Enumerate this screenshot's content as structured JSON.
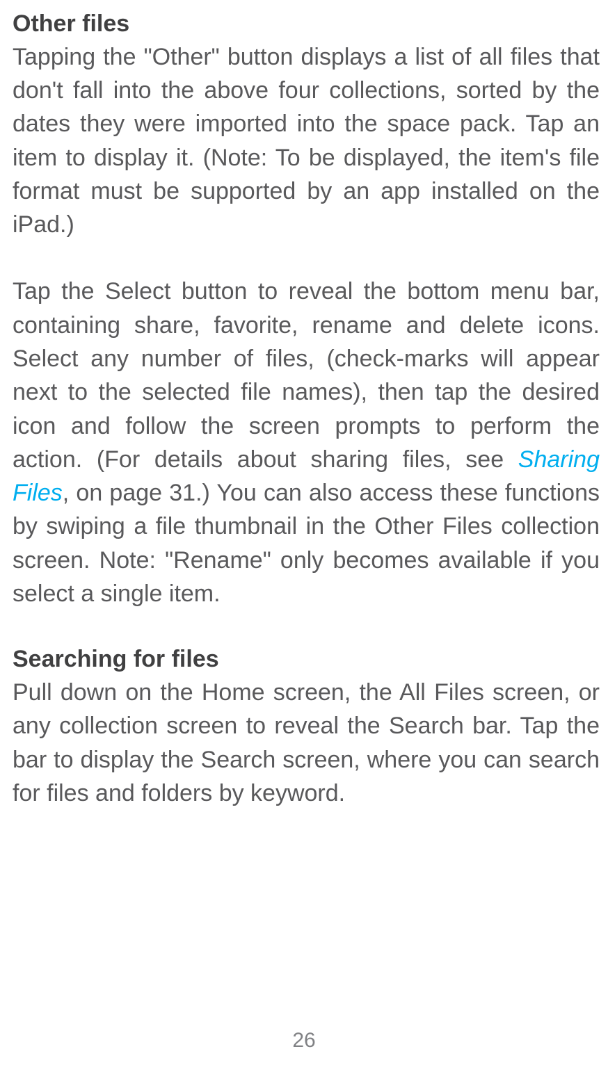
{
  "section1": {
    "heading": "Other files",
    "para1": "Tapping the \"Other\" button displays a list of all files that don't fall into the above four collections, sorted by the dates they were imported into the space pack. Tap an item to display it. (Note: To be displayed, the item's file format must be supported by an app installed on the iPad.)",
    "para2_before_link": "Tap the Select button to reveal the bottom menu bar, containing share, favorite, rename and delete icons. Select any number of files, (check-marks will appear next to the selected file names), then tap the desired icon and follow the screen prompts to perform the action. (For details about sharing files, see ",
    "para2_link": "Sharing Files",
    "para2_after_link": ", on page 31.) You can also access these functions by swiping a file thumbnail in the Other Files collection screen. Note: \"Rename\" only becomes available if you select a single item."
  },
  "section2": {
    "heading": "Searching for files",
    "para1": "Pull down on the Home screen, the All Files screen, or any collection screen to reveal the Search bar. Tap the bar to display the Search screen, where you can search for files and folders by keyword."
  },
  "page_number": "26"
}
